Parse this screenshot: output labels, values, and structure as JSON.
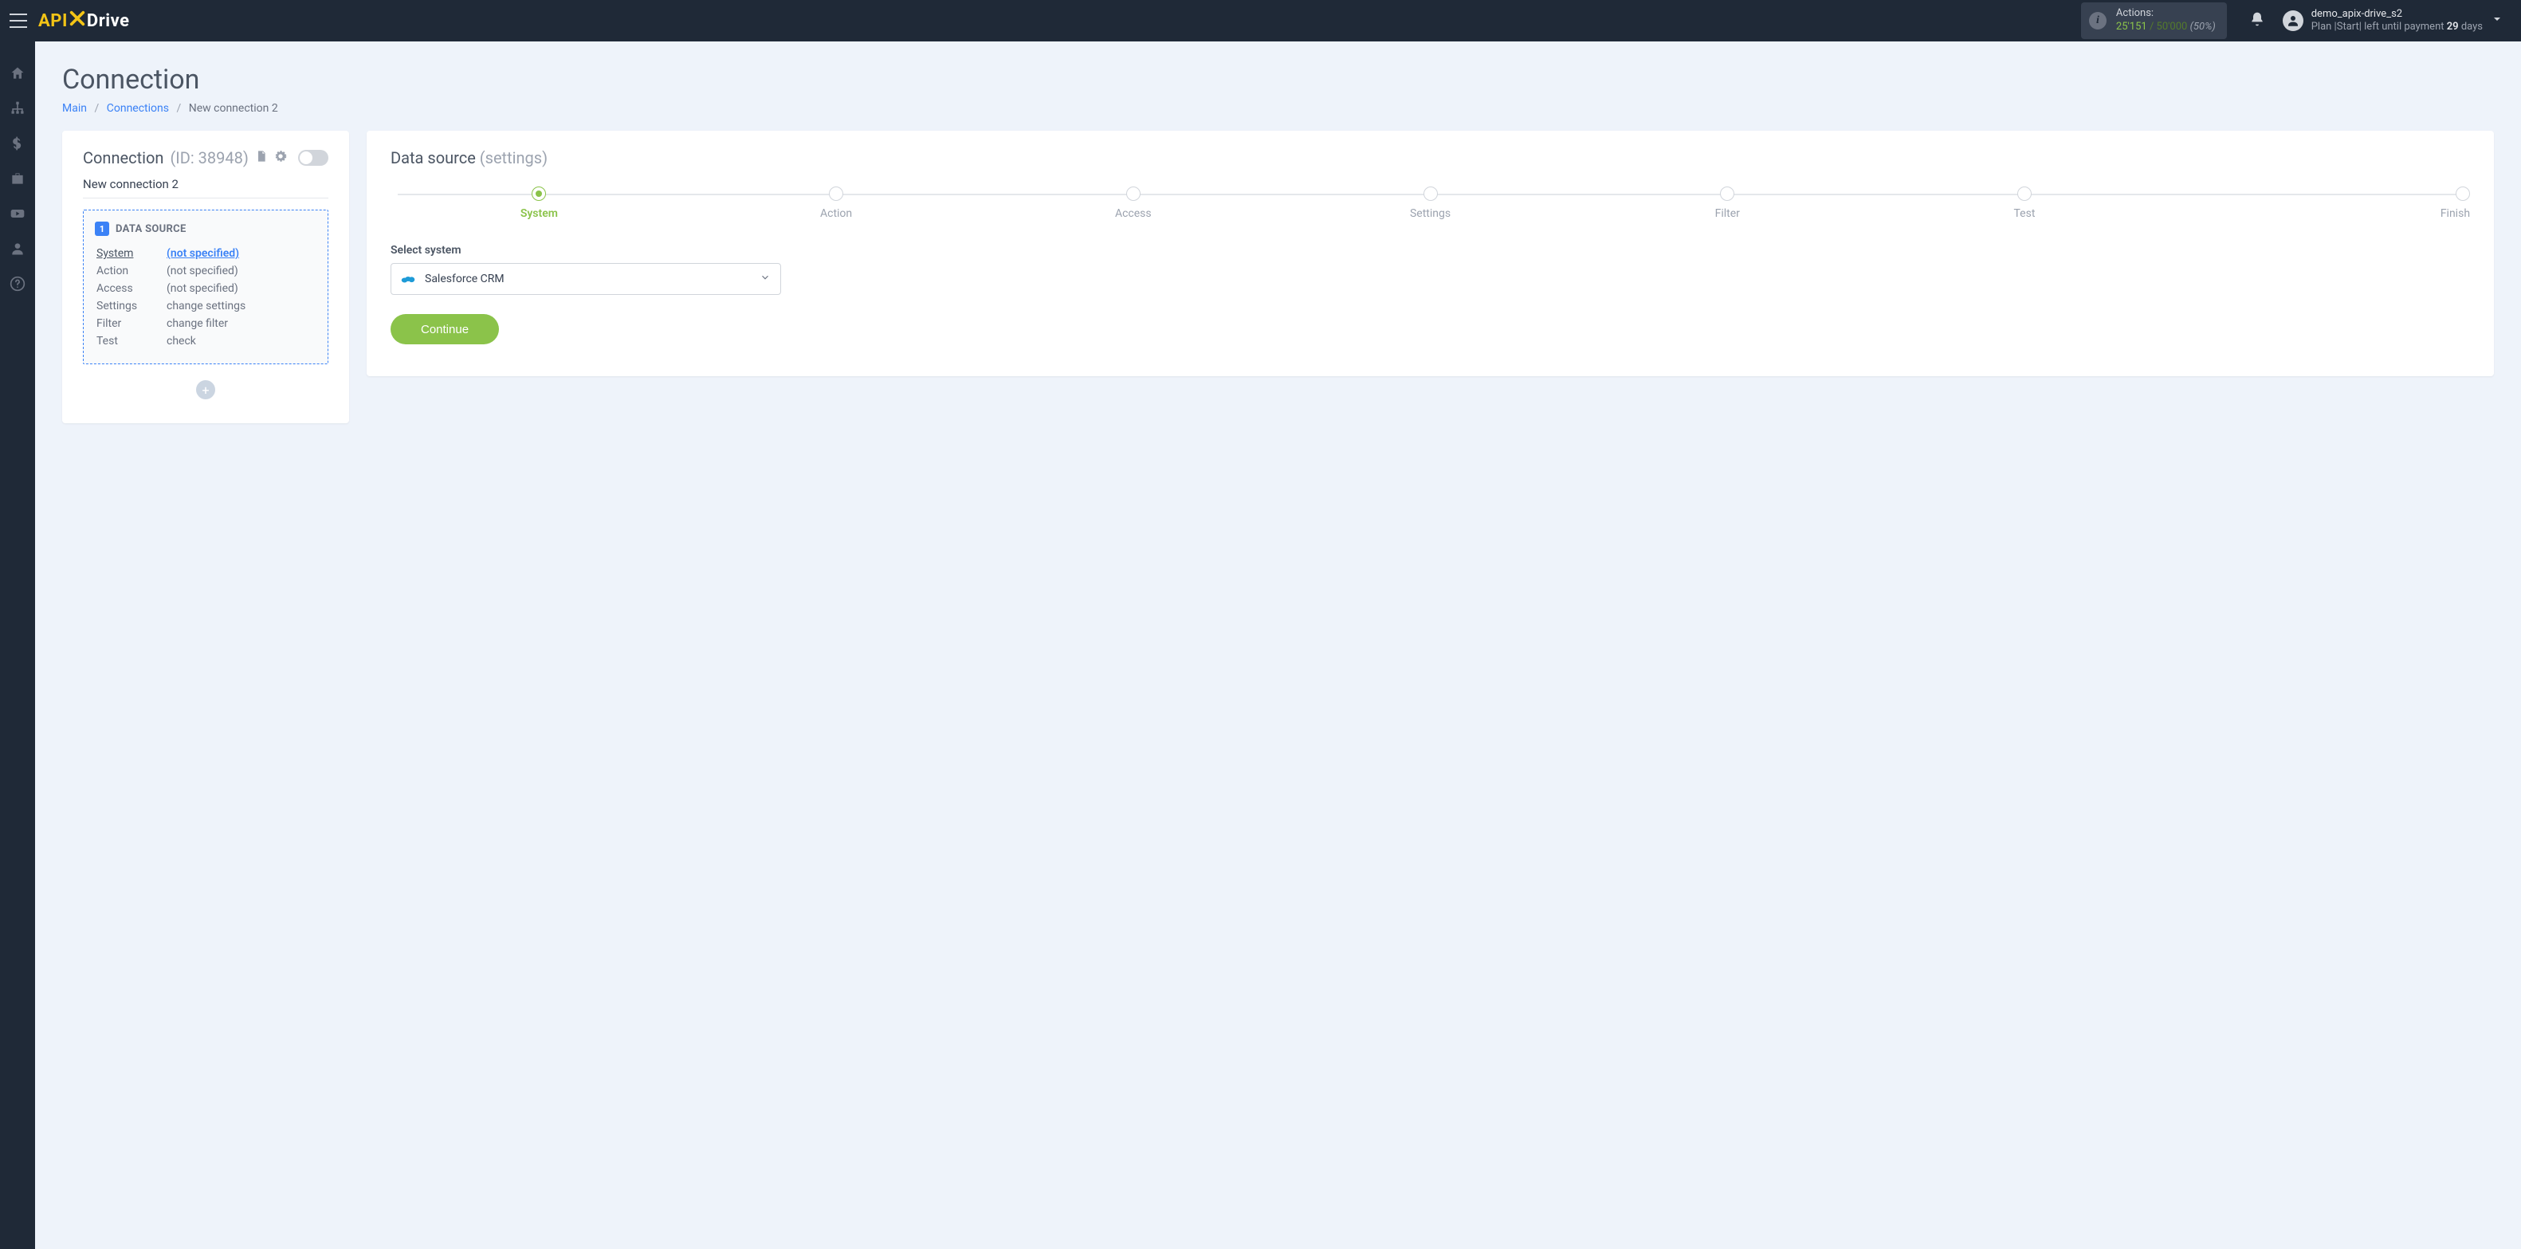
{
  "logo": {
    "api": "API",
    "drive": "Drive"
  },
  "header": {
    "actions_label": "Actions:",
    "actions_used": "25'151",
    "actions_sep": " / ",
    "actions_limit": "50'000",
    "actions_pct": "(50%)",
    "user_name": "demo_apix-drive_s2",
    "plan_prefix": "Plan |Start| left until payment ",
    "plan_days_num": "29",
    "plan_days_suffix": " days"
  },
  "page": {
    "title": "Connection",
    "breadcrumb": {
      "main": "Main",
      "connections": "Connections",
      "current": "New connection 2"
    }
  },
  "left": {
    "title": "Connection",
    "id_label": "(ID: 38948)",
    "name": "New connection 2",
    "ds_badge": "1",
    "ds_title": "DATA SOURCE",
    "rows": [
      {
        "key": "System",
        "val": "(not specified)",
        "active": true,
        "link": true
      },
      {
        "key": "Action",
        "val": "(not specified)"
      },
      {
        "key": "Access",
        "val": "(not specified)"
      },
      {
        "key": "Settings",
        "val": "change settings"
      },
      {
        "key": "Filter",
        "val": "change filter"
      },
      {
        "key": "Test",
        "val": "check"
      }
    ]
  },
  "right": {
    "title": "Data source",
    "subtitle": "(settings)",
    "steps": [
      "System",
      "Action",
      "Access",
      "Settings",
      "Filter",
      "Test",
      "Finish"
    ],
    "active_step": 0,
    "select_label": "Select system",
    "select_value": "Salesforce CRM",
    "continue": "Continue"
  }
}
